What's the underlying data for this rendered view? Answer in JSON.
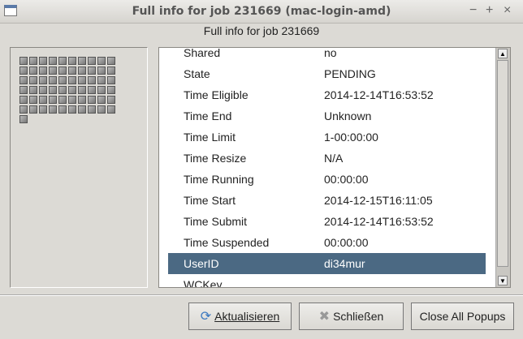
{
  "window": {
    "title": "Full info for job 231669 (mac-login-amd)",
    "controls": [
      "−",
      "+",
      "×"
    ]
  },
  "subtitle": "Full info for job 231669",
  "node_grid": {
    "count": 61
  },
  "rows": [
    {
      "key": "Shared",
      "value": "no"
    },
    {
      "key": "State",
      "value": "PENDING"
    },
    {
      "key": "Time Eligible",
      "value": "2014-12-14T16:53:52"
    },
    {
      "key": "Time End",
      "value": "Unknown"
    },
    {
      "key": "Time Limit",
      "value": "1-00:00:00"
    },
    {
      "key": "Time Resize",
      "value": "N/A"
    },
    {
      "key": "Time Running",
      "value": "00:00:00"
    },
    {
      "key": "Time Start",
      "value": "2014-12-15T16:11:05"
    },
    {
      "key": "Time Submit",
      "value": "2014-12-14T16:53:52"
    },
    {
      "key": "Time Suspended",
      "value": "00:00:00"
    },
    {
      "key": "UserID",
      "value": "di34mur",
      "selected": true
    },
    {
      "key": "WCKey",
      "value": ""
    }
  ],
  "buttons": {
    "refresh": "Aktualisieren",
    "close": "Schließen",
    "close_all": "Close All Popups"
  },
  "colors": {
    "selection": "#4b6983"
  }
}
